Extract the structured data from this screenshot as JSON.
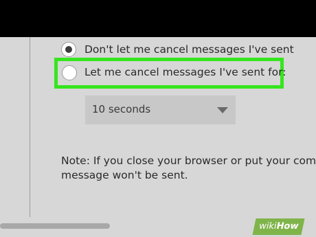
{
  "settings": {
    "options": [
      {
        "label": "Don't let me cancel messages I've sent",
        "selected": true
      },
      {
        "label": "Let me cancel messages I've sent for:",
        "selected": false
      }
    ],
    "cancel_duration": {
      "selected": "10 seconds"
    },
    "note": {
      "line1": "Note: If you close your browser or put your com",
      "line2": "message won't be sent."
    }
  },
  "watermark": {
    "wiki": "wiki",
    "how": "How"
  },
  "colors": {
    "highlight": "#35e51e",
    "top_bar": "#000000",
    "background": "#d7d7d7",
    "watermark_bg": "#7fb44a"
  }
}
